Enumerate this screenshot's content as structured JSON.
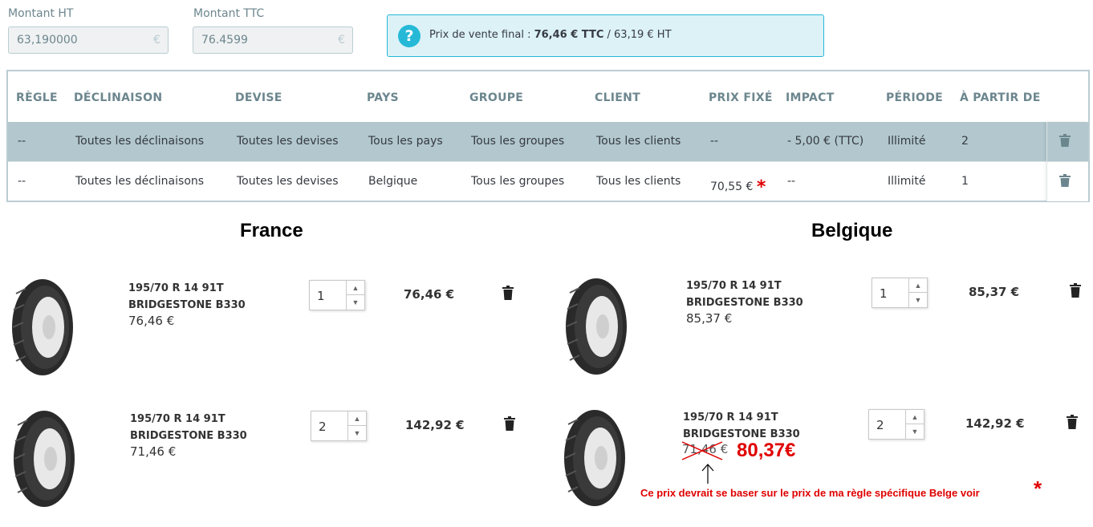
{
  "amounts": {
    "ht_label": "Montant HT",
    "ht_value": "63,190000",
    "ttc_label": "Montant TTC",
    "ttc_value": "76.4599",
    "currency": "€"
  },
  "info": {
    "prefix": "Prix de vente final : ",
    "ttc": "76,46 € TTC",
    "suffix": " / 63,19 € HT",
    "icon": "question-icon"
  },
  "table": {
    "headers": [
      "RÈGLE",
      "DÉCLINAISON",
      "DEVISE",
      "PAYS",
      "GROUPE",
      "CLIENT",
      "PRIX FIXÉ",
      "IMPACT",
      "PÉRIODE",
      "À PARTIR DE"
    ],
    "rows": [
      [
        "--",
        "Toutes les déclinaisons",
        "Toutes les devises",
        "Tous les pays",
        "Tous les groupes",
        "Tous les clients",
        "--",
        "- 5,00 € (TTC)",
        "Illimité",
        "2"
      ],
      [
        "--",
        "Toutes les déclinaisons",
        "Toutes les devises",
        "Belgique",
        "Tous les groupes",
        "Tous les clients",
        "70,55 €",
        "--",
        "Illimité",
        "1"
      ]
    ],
    "star": "*",
    "delete_icon": "trash-icon"
  },
  "france": {
    "title": "France",
    "items": [
      {
        "name1": "195/70 R 14 91T",
        "name2": "BRIDGESTONE B330",
        "unit_price": "76,46 €",
        "qty": "1",
        "total": "76,46 €"
      },
      {
        "name1": "195/70 R 14 91T",
        "name2": "BRIDGESTONE B330",
        "unit_price": "71,46 €",
        "qty": "2",
        "total": "142,92 €"
      }
    ]
  },
  "belgique": {
    "title": "Belgique",
    "items": [
      {
        "name1": "195/70 R 14 91T",
        "name2": "BRIDGESTONE B330",
        "unit_price": "85,37 €",
        "qty": "1",
        "total": "85,37 €"
      },
      {
        "name1": "195/70 R 14 91T",
        "name2": "BRIDGESTONE B330",
        "unit_price": "71,46 €",
        "qty": "2",
        "total": "142,92 €"
      }
    ]
  },
  "annotation": {
    "corrected_price": "80,37€",
    "note": "Ce prix devrait se baser sur le prix de ma règle spécifique Belge voir",
    "star": "*"
  },
  "colors": {
    "accent": "#25b9d7",
    "highlight_row": "#b2c7ce",
    "annotation": "#e00000"
  }
}
